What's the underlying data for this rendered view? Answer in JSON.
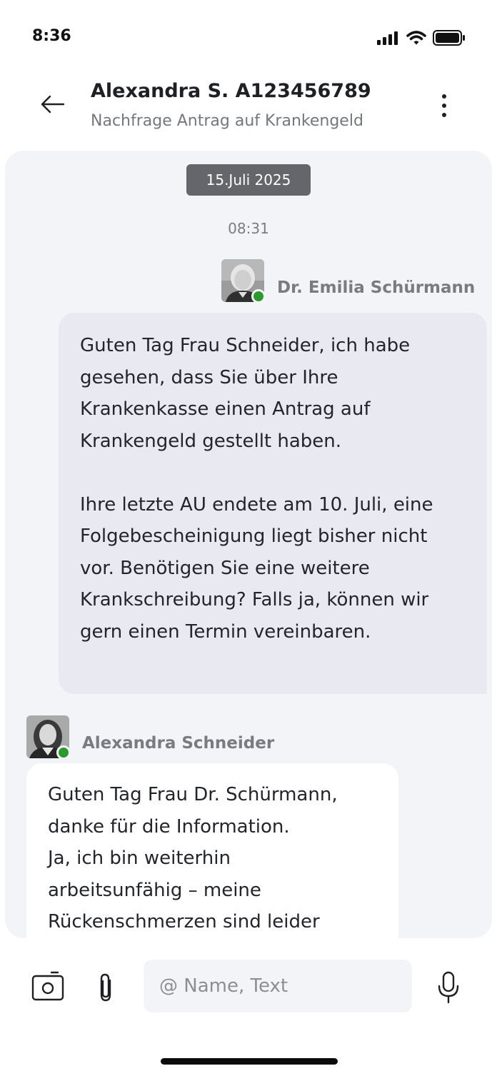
{
  "status_bar": {
    "time": "8:36",
    "icons": [
      "signal-icon",
      "wifi-icon",
      "battery-icon"
    ]
  },
  "header": {
    "title": "Alexandra S. A123456789",
    "subtitle": "Nachfrage Antrag auf Krankengeld",
    "icons": [
      "back-arrow-icon",
      "more-vertical-icon"
    ]
  },
  "chat": {
    "date_chip": "15.Juli 2025",
    "time": "08:31",
    "messages": [
      {
        "sender": "Dr. Emilia Schürmann",
        "online": true,
        "paragraphs": [
          "Guten Tag Frau Schneider, ich habe gesehen, dass Sie über Ihre Krankenkasse einen Antrag auf Krankengeld gestellt haben.",
          "Ihre letzte AU endete am 10. Juli, eine Folgebescheinigung liegt bisher nicht vor. Benötigen Sie eine weitere Krankschreibung? Falls ja, können wir gern einen Termin vereinbaren."
        ]
      },
      {
        "sender": "Alexandra Schneider",
        "online": true,
        "text": "Guten Tag Frau Dr. Schürmann,\ndanke für die Information.\nJa, ich bin weiterhin\narbeitsunfähig – meine\nRückenschmerzen sind leider"
      }
    ]
  },
  "composer": {
    "placeholder": "@ Name, Text",
    "icons": [
      "camera-icon",
      "paperclip-icon",
      "microphone-icon"
    ]
  },
  "colors": {
    "chat_background": "#f3f4f8",
    "doctor_bubble": "#e9eaf1",
    "patient_bubble": "#ffffff",
    "date_chip": "#65666b",
    "online": "#2a9a2a"
  }
}
